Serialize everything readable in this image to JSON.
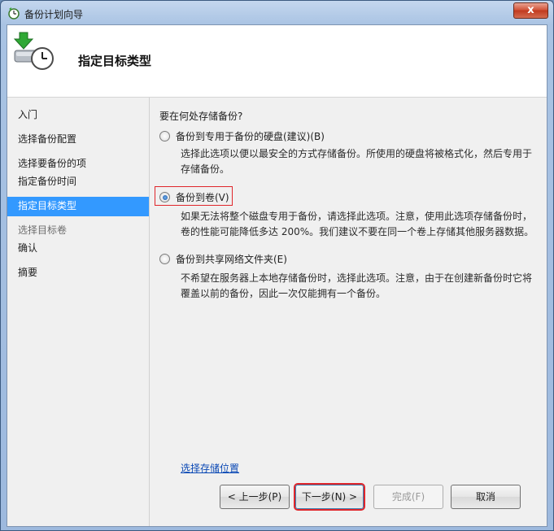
{
  "window": {
    "title": "备份计划向导",
    "close_label": "x"
  },
  "header": {
    "title": "指定目标类型"
  },
  "sidebar": {
    "items": [
      {
        "label": "入门",
        "state": "normal"
      },
      {
        "label": "选择备份配置",
        "state": "normal"
      },
      {
        "label": "选择要备份的项",
        "state": "normal"
      },
      {
        "label": "指定备份时间",
        "state": "normal"
      },
      {
        "label": "指定目标类型",
        "state": "active"
      },
      {
        "label": "选择目标卷",
        "state": "disabled"
      },
      {
        "label": "确认",
        "state": "normal"
      },
      {
        "label": "摘要",
        "state": "normal"
      }
    ]
  },
  "main": {
    "question": "要在何处存储备份?",
    "options": [
      {
        "label": "备份到专用于备份的硬盘(建议)(B)",
        "checked": false,
        "description": "选择此选项以便以最安全的方式存储备份。所使用的硬盘将被格式化，然后专用于存储备份。"
      },
      {
        "label": "备份到卷(V)",
        "checked": true,
        "description": "如果无法将整个磁盘专用于备份，请选择此选项。注意，使用此选项存储备份时，卷的性能可能降低多达 200%。我们建议不要在同一个卷上存储其他服务器数据。"
      },
      {
        "label": "备份到共享网络文件夹(E)",
        "checked": false,
        "description": "不希望在服务器上本地存储备份时，选择此选项。注意，由于在创建新备份时它将覆盖以前的备份，因此一次仅能拥有一个备份。"
      }
    ],
    "link": "选择存储位置"
  },
  "buttons": {
    "prev": "< 上一步(P)",
    "next": "下一步(N) >",
    "finish": "完成(F)",
    "cancel": "取消"
  },
  "colors": {
    "active_nav": "#3399ff",
    "highlight_box": "#e0262b",
    "link": "#0b49b5"
  }
}
